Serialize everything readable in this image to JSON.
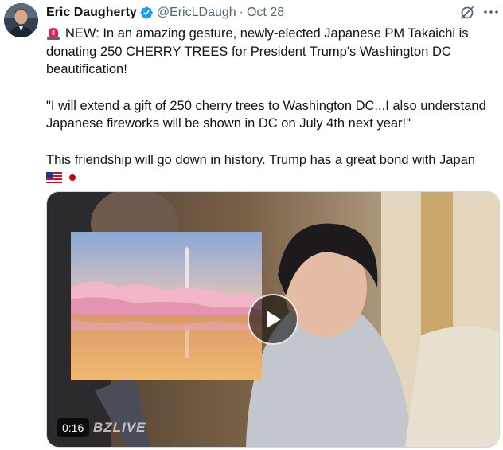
{
  "tweet": {
    "author_name": "Eric Daugherty",
    "handle": "@EricLDaugh",
    "separator": "·",
    "date": "Oct 28",
    "line1_text": "NEW: In an amazing gesture, newly-elected Japanese PM Takaichi is donating 250 CHERRY TREES for President Trump's Washington DC beautification!",
    "quote_text": "\"I will extend a gift of 250 cherry trees to Washington DC...I also understand Japanese fireworks will be shown in DC on July 4th next year!\"",
    "closing_text": "This friendship will go down in history. Trump has a great bond with Japan",
    "icons": [
      "siren-icon",
      "us-flag-icon",
      "japan-flag-icon",
      "verified-badge-icon",
      "grok-icon",
      "more-icon",
      "play-icon"
    ]
  },
  "video": {
    "duration": "0:16",
    "watermark": "BZLIVE"
  },
  "colors": {
    "verified_blue": "#1d9bf0",
    "secondary_text": "#536471",
    "primary_text": "#0f1419"
  }
}
